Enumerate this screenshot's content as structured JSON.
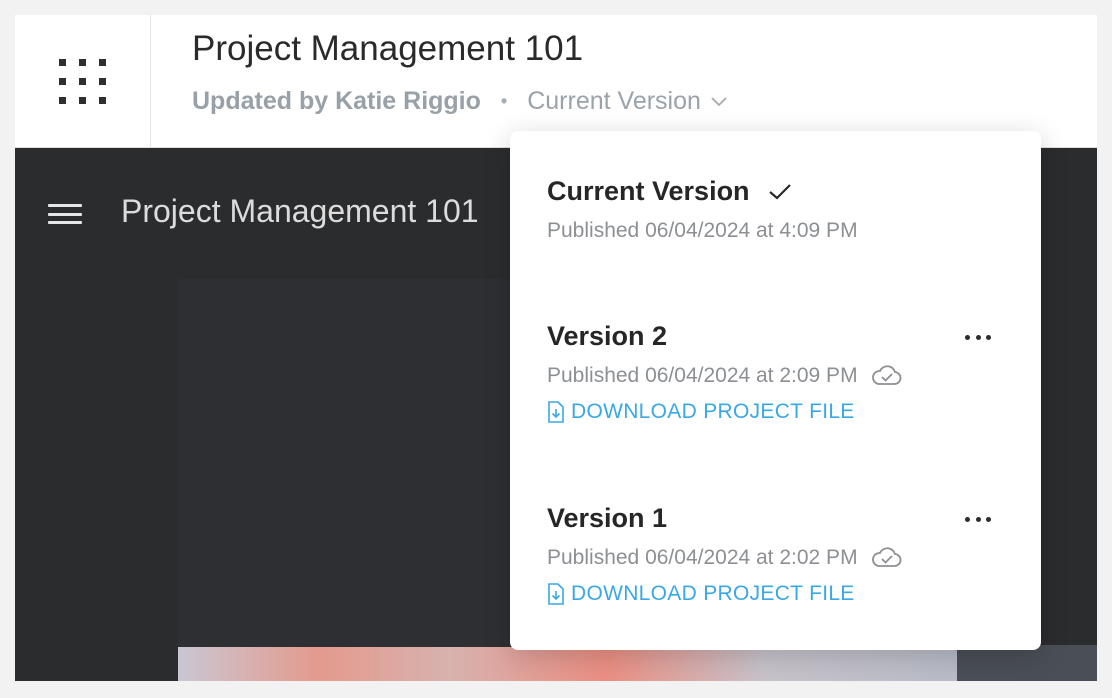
{
  "header": {
    "apps_icon": "grid-dots-icon",
    "title": "Project Management 101",
    "updated_by": "Updated by Katie Riggio",
    "separator": "•",
    "version_selector": "Current Version",
    "version_chevron_icon": "chevron-down-icon"
  },
  "player": {
    "menu_icon": "hamburger-menu-icon",
    "title": "Project Management 101"
  },
  "versions_menu": {
    "items": [
      {
        "title": "Current Version",
        "selected": true,
        "published": "Published 06/04/2024 at 4:09 PM"
      },
      {
        "title": "Version 2",
        "published": "Published 06/04/2024 at 2:09 PM",
        "cloud_icon": "cloud-check-icon",
        "download_label": "DOWNLOAD PROJECT FILE",
        "more_icon": "more-horizontal-icon"
      },
      {
        "title": "Version 1",
        "published": "Published 06/04/2024 at 2:02 PM",
        "cloud_icon": "cloud-check-icon",
        "download_label": "DOWNLOAD PROJECT FILE",
        "more_icon": "more-horizontal-icon"
      }
    ]
  },
  "colors": {
    "link": "#3aa7e6",
    "dark_bg": "#2b2c2e",
    "muted_text": "#8c8f93"
  }
}
